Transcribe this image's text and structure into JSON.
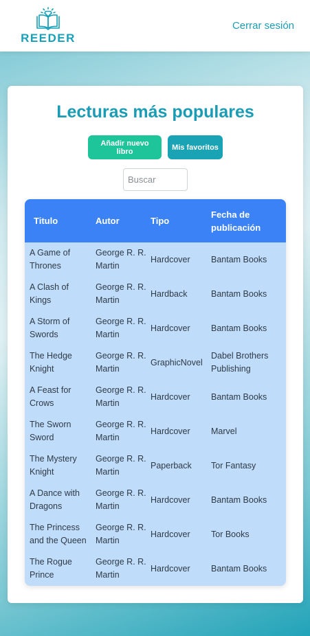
{
  "header": {
    "logo_text": "REEDER",
    "logout_label": "Cerrar sesión"
  },
  "main": {
    "title": "Lecturas más populares",
    "add_button": "Añadir nuevo libro",
    "favorites_button": "Mis favoritos",
    "search_placeholder": "Buscar"
  },
  "table": {
    "headers": [
      "Titulo",
      "Autor",
      "Tipo",
      "Fecha de publicación"
    ],
    "rows": [
      [
        "A Game of Thrones",
        "George R. R. Martin",
        "Hardcover",
        "Bantam Books"
      ],
      [
        "A Clash of Kings",
        "George R. R. Martin",
        "Hardback",
        "Bantam Books"
      ],
      [
        "A Storm of Swords",
        "George R. R. Martin",
        "Hardcover",
        "Bantam Books"
      ],
      [
        "The Hedge Knight",
        "George R. R. Martin",
        "GraphicNovel",
        "Dabel Brothers Publishing"
      ],
      [
        "A Feast for Crows",
        "George R. R. Martin",
        "Hardcover",
        "Bantam Books"
      ],
      [
        "The Sworn Sword",
        "George R. R. Martin",
        "Hardcover",
        "Marvel"
      ],
      [
        "The Mystery Knight",
        "George R. R. Martin",
        "Paperback",
        "Tor Fantasy"
      ],
      [
        "A Dance with Dragons",
        "George R. R. Martin",
        "Hardcover",
        "Bantam Books"
      ],
      [
        "The Princess and the Queen",
        "George R. R. Martin",
        "Hardcover",
        "Tor Books"
      ],
      [
        "The Rogue Prince",
        "George R. R. Martin",
        "Hardcover",
        "Bantam Books"
      ]
    ]
  },
  "colors": {
    "brand": "#18a0b8",
    "add_button": "#1fc59a",
    "favorites_button": "#1aa3b4",
    "table_header": "#3b82f6",
    "table_body": "#bfdcfb"
  },
  "icons": {
    "logo": "open-book-with-diamond-icon"
  }
}
